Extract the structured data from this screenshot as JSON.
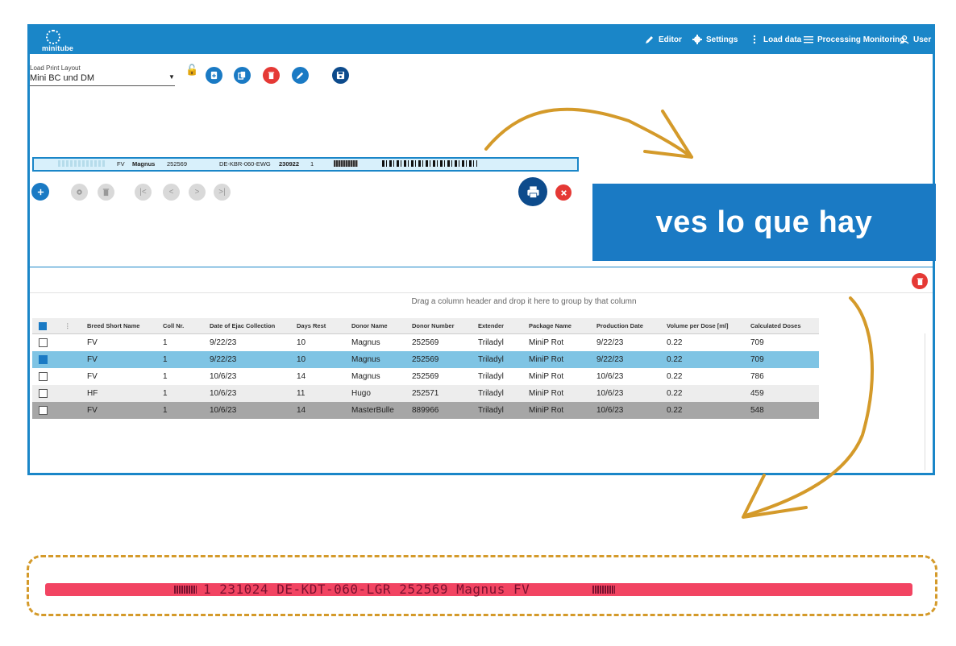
{
  "app": {
    "logo": "minitube"
  },
  "nav": {
    "editor": "Editor",
    "settings": "Settings",
    "load_data": "Load data",
    "processing_monitoring": "Processing Monitoring",
    "user": "User"
  },
  "layout": {
    "label": "Load Print Layout",
    "value": "Mini BC und DM"
  },
  "strip": {
    "breed": "FV",
    "donor": "Magnus",
    "number": "252569",
    "code": "DE-KBR-060-EWG",
    "date": "230922",
    "coll": "1"
  },
  "banner": {
    "text": "ves lo que hay"
  },
  "grid": {
    "group_hint": "Drag a column header and drop it here to group by that column",
    "columns": [
      "Breed Short Name",
      "Coll Nr.",
      "Date of Ejac Collection",
      "Days Rest",
      "Donor Name",
      "Donor Number",
      "Extender",
      "Package Name",
      "Production Date",
      "Volume per Dose [ml]",
      "Calculated Doses"
    ],
    "rows": [
      {
        "breed": "FV",
        "coll": "1",
        "date": "9/22/23",
        "days": "10",
        "donor": "Magnus",
        "number": "252569",
        "extender": "Triladyl",
        "package": "MiniP Rot",
        "prod": "9/22/23",
        "volume": "0.22",
        "doses": "709"
      },
      {
        "breed": "FV",
        "coll": "1",
        "date": "9/22/23",
        "days": "10",
        "donor": "Magnus",
        "number": "252569",
        "extender": "Triladyl",
        "package": "MiniP Rot",
        "prod": "9/22/23",
        "volume": "0.22",
        "doses": "709"
      },
      {
        "breed": "FV",
        "coll": "1",
        "date": "10/6/23",
        "days": "14",
        "donor": "Magnus",
        "number": "252569",
        "extender": "Triladyl",
        "package": "MiniP Rot",
        "prod": "10/6/23",
        "volume": "0.22",
        "doses": "786"
      },
      {
        "breed": "HF",
        "coll": "1",
        "date": "10/6/23",
        "days": "11",
        "donor": "Hugo",
        "number": "252571",
        "extender": "Triladyl",
        "package": "MiniP Rot",
        "prod": "10/6/23",
        "volume": "0.22",
        "doses": "459"
      },
      {
        "breed": "FV",
        "coll": "1",
        "date": "10/6/23",
        "days": "14",
        "donor": "MasterBulle",
        "number": "889966",
        "extender": "Triladyl",
        "package": "MiniP Rot",
        "prod": "10/6/23",
        "volume": "0.22",
        "doses": "548"
      }
    ]
  },
  "straw": {
    "text": "1 231024 DE-KDT-060-LGR 252569 Magnus FV"
  },
  "colors": {
    "brand": "#1a86c8",
    "banner": "#1a7ac4",
    "accent_arrow": "#d49a2a",
    "straw": "#f24462",
    "selected_row": "#7fc4e4",
    "dark_row": "#a6a6a6"
  }
}
